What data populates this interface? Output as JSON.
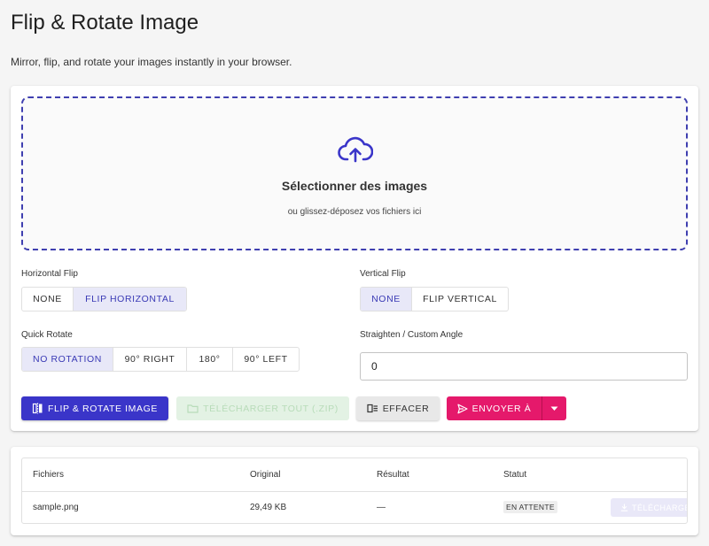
{
  "header": {
    "title": "Flip & Rotate Image",
    "subtitle": "Mirror, flip, and rotate your images instantly in your browser."
  },
  "dropzone": {
    "icon": "cloud-upload-icon",
    "title": "Sélectionner des images",
    "hint": "ou glissez-déposez vos fichiers ici"
  },
  "horizontal_flip": {
    "label": "Horizontal Flip",
    "options": [
      "NONE",
      "FLIP HORIZONTAL"
    ],
    "selected": "FLIP HORIZONTAL"
  },
  "vertical_flip": {
    "label": "Vertical Flip",
    "options": [
      "NONE",
      "FLIP VERTICAL"
    ],
    "selected": "NONE"
  },
  "quick_rotate": {
    "label": "Quick Rotate",
    "options": [
      "NO ROTATION",
      "90° RIGHT",
      "180°",
      "90° LEFT"
    ],
    "selected": "NO ROTATION"
  },
  "custom_angle": {
    "label": "Straighten / Custom Angle",
    "value": "0"
  },
  "actions": {
    "process_label": "FLIP & ROTATE IMAGE",
    "zip_label": "TÉLÉCHARGER TOUT (.ZIP)",
    "clear_label": "EFFACER",
    "send_label": "ENVOYER À"
  },
  "table": {
    "headers": [
      "Fichiers",
      "Original",
      "Résultat",
      "Statut"
    ],
    "rows": [
      {
        "file": "sample.png",
        "original": "29,49 KB",
        "result": "—",
        "status": "EN ATTENTE",
        "download_label": "TÉLÉCHARGER"
      }
    ]
  },
  "colors": {
    "primary": "#3a35c9",
    "accent": "#e5196b",
    "selected_bg": "#e8e8f8",
    "zip_disabled_bg": "#e3f2e4"
  }
}
